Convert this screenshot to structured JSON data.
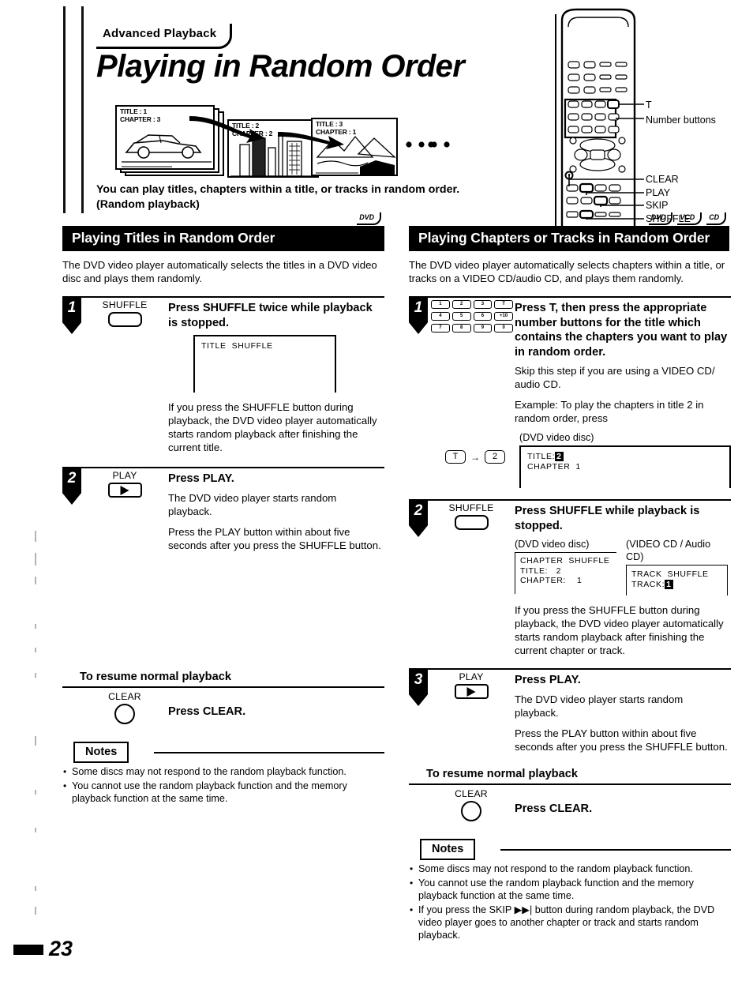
{
  "document": {
    "kicker": "Advanced Playback",
    "title": "Playing in Random Order",
    "page_number": "23"
  },
  "illustration": {
    "panels": [
      {
        "title_line": "TITLE : 1",
        "chapter_line": "CHAPTER : 3",
        "scene": "car"
      },
      {
        "title_line": "TITLE : 2",
        "chapter_line": "CHAPTER : 2",
        "scene": "city"
      },
      {
        "title_line": "TITLE : 3",
        "chapter_line": "CHAPTER : 1",
        "scene": "mountains"
      }
    ],
    "ellipsis_dots": 5
  },
  "intro": {
    "line1": "You can play titles, chapters within a title, or tracks in random order.",
    "line2": "(Random playback)"
  },
  "remote": {
    "callouts": [
      {
        "label": "T"
      },
      {
        "label": "Number buttons"
      },
      {
        "label": "CLEAR"
      },
      {
        "label": "PLAY"
      },
      {
        "label": "SKIP"
      },
      {
        "label": "SHUFFLE"
      }
    ]
  },
  "left_column": {
    "heading": "Playing Titles in Random Order",
    "badges": [
      "DVD"
    ],
    "lede": "The DVD video player automatically selects the titles in a DVD video disc and plays them randomly.",
    "steps": [
      {
        "number": "1",
        "key_name": "SHUFFLE",
        "key_type": "rounded-button",
        "title": "Press SHUFFLE twice while playback is stopped.",
        "osd": {
          "line1": "TITLE  SHUFFLE"
        },
        "paragraphs": [
          "If you press the SHUFFLE button during playback, the DVD video player automatically starts random playback after finishing the current title."
        ]
      },
      {
        "number": "2",
        "key_name": "PLAY",
        "key_type": "play-button",
        "title": "Press PLAY.",
        "paragraphs": [
          "The DVD video player starts random playback.",
          "Press the PLAY button within about five seconds after you press the SHUFFLE button."
        ]
      }
    ],
    "resume": {
      "heading": "To resume normal playback",
      "key_name": "CLEAR",
      "key_type": "circle-button",
      "instruction": "Press CLEAR."
    },
    "notes": {
      "tab_label": "Notes",
      "items": [
        "Some discs may not respond to the random playback function.",
        "You cannot use the random playback function and the memory playback function at the same time."
      ]
    }
  },
  "right_column": {
    "heading": "Playing Chapters or Tracks in Random Order",
    "badges": [
      "DVD",
      "VCD",
      "CD"
    ],
    "lede": "The DVD video player automatically selects chapters within a title, or tracks on a VIDEO CD/audio CD, and plays them randomly.",
    "steps": [
      {
        "number": "1",
        "key_type": "number-pad",
        "numpad_keys": [
          "1",
          "2",
          "3",
          "T",
          "4",
          "5",
          "6",
          "+10",
          "7",
          "8",
          "9",
          "0"
        ],
        "title": "Press T, then press the appropriate number buttons for the title which contains the chapters you want to play in random order.",
        "paragraphs": [
          "Skip this step if you are using a VIDEO CD/ audio CD."
        ],
        "example_label": "Example: To play the chapters in title 2 in random order, press",
        "key_sequence": {
          "first": "T",
          "arrow": "→",
          "second": "2"
        },
        "osd_caption": "(DVD video disc)",
        "osd": {
          "label1": "TITLE:",
          "value1": "2",
          "label2": "CHAPTER",
          "value2": "1"
        }
      },
      {
        "number": "2",
        "key_name": "SHUFFLE",
        "key_type": "rounded-button",
        "title": "Press SHUFFLE while playback is stopped.",
        "osd_dvd": {
          "caption": "(DVD video disc)",
          "line1": "CHAPTER  SHUFFLE",
          "line2": "TITLE:   2",
          "line3": "CHAPTER:    1"
        },
        "osd_cd": {
          "caption": "(VIDEO CD / Audio CD)",
          "line1": "TRACK  SHUFFLE",
          "line2_label": "TRACK:",
          "line2_value": "1"
        },
        "paragraphs": [
          "If you press the SHUFFLE button during playback, the DVD video player automatically starts random playback after finishing the current chapter or track."
        ]
      },
      {
        "number": "3",
        "key_name": "PLAY",
        "key_type": "play-button",
        "title": "Press PLAY.",
        "paragraphs": [
          "The DVD video player starts random playback.",
          "Press the PLAY button within about five seconds after you press the SHUFFLE button."
        ]
      }
    ],
    "resume": {
      "heading": "To resume normal playback",
      "key_name": "CLEAR",
      "key_type": "circle-button",
      "instruction": "Press CLEAR."
    },
    "notes": {
      "tab_label": "Notes",
      "items": [
        "Some discs may not respond to the random playback function.",
        "You cannot use the random playback function and the memory playback function at the same time.",
        "If you press the SKIP ▶▶| button during random playback, the DVD video player goes to another chapter or track and starts random playback."
      ]
    }
  }
}
